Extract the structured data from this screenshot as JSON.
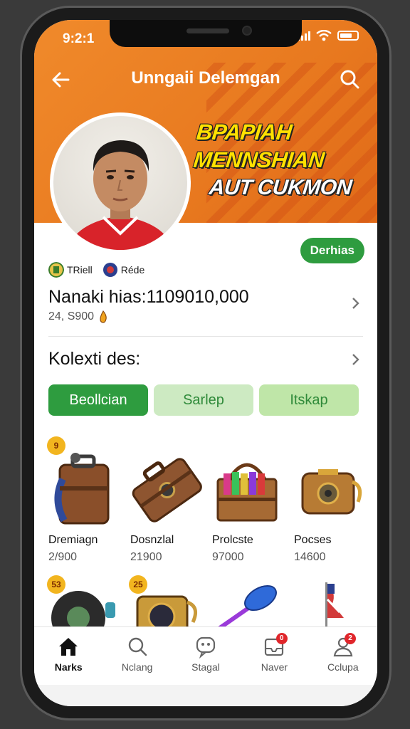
{
  "status": {
    "time": "9:2:1"
  },
  "header": {
    "title": "Unngaii Delemgan"
  },
  "promo": {
    "line1": "BPAPIAH",
    "line2": "MENNSHIAN",
    "line3": "AUT CUKMON"
  },
  "profile": {
    "follow_label": "Derhias",
    "tags": [
      {
        "label": "TRiell",
        "icon": "team-crest-icon"
      },
      {
        "label": "Réde",
        "icon": "club-crest-icon"
      }
    ],
    "balance_title": "Nanaki hias:1109010,000",
    "balance_sub": "24, S900"
  },
  "collection": {
    "title": "Kolexti des:",
    "filters": [
      "Beollcian",
      "Sarlep",
      "Itskap"
    ],
    "items": [
      {
        "name": "Dremiagn",
        "price": "2/900",
        "badge": "9",
        "icon": "suitcase-icon"
      },
      {
        "name": "Dosnzlal",
        "price": "21900",
        "badge": "",
        "icon": "briefcase-icon"
      },
      {
        "name": "Prolcste",
        "price": "97000",
        "badge": "",
        "icon": "crate-icon"
      },
      {
        "name": "Pocses",
        "price": "14600",
        "badge": "",
        "icon": "chest-icon"
      }
    ],
    "items_row2": [
      {
        "badge": "53",
        "icon": "record-icon"
      },
      {
        "badge": "25",
        "icon": "lantern-icon"
      },
      {
        "badge": "",
        "icon": "torch-icon"
      },
      {
        "badge": "",
        "icon": "flag-icon"
      }
    ]
  },
  "nav": [
    {
      "label": "Narks",
      "icon": "home-icon",
      "active": true,
      "badge": ""
    },
    {
      "label": "Nclang",
      "icon": "search-icon",
      "active": false,
      "badge": ""
    },
    {
      "label": "Stagal",
      "icon": "chat-icon",
      "active": false,
      "badge": ""
    },
    {
      "label": "Naver",
      "icon": "inbox-icon",
      "active": false,
      "badge": "0"
    },
    {
      "label": "Cclupa",
      "icon": "profile-icon",
      "active": false,
      "badge": "2"
    }
  ],
  "colors": {
    "header": "#f08a2b",
    "accent": "#2e9c3f",
    "promo_text": "#ffe100"
  }
}
